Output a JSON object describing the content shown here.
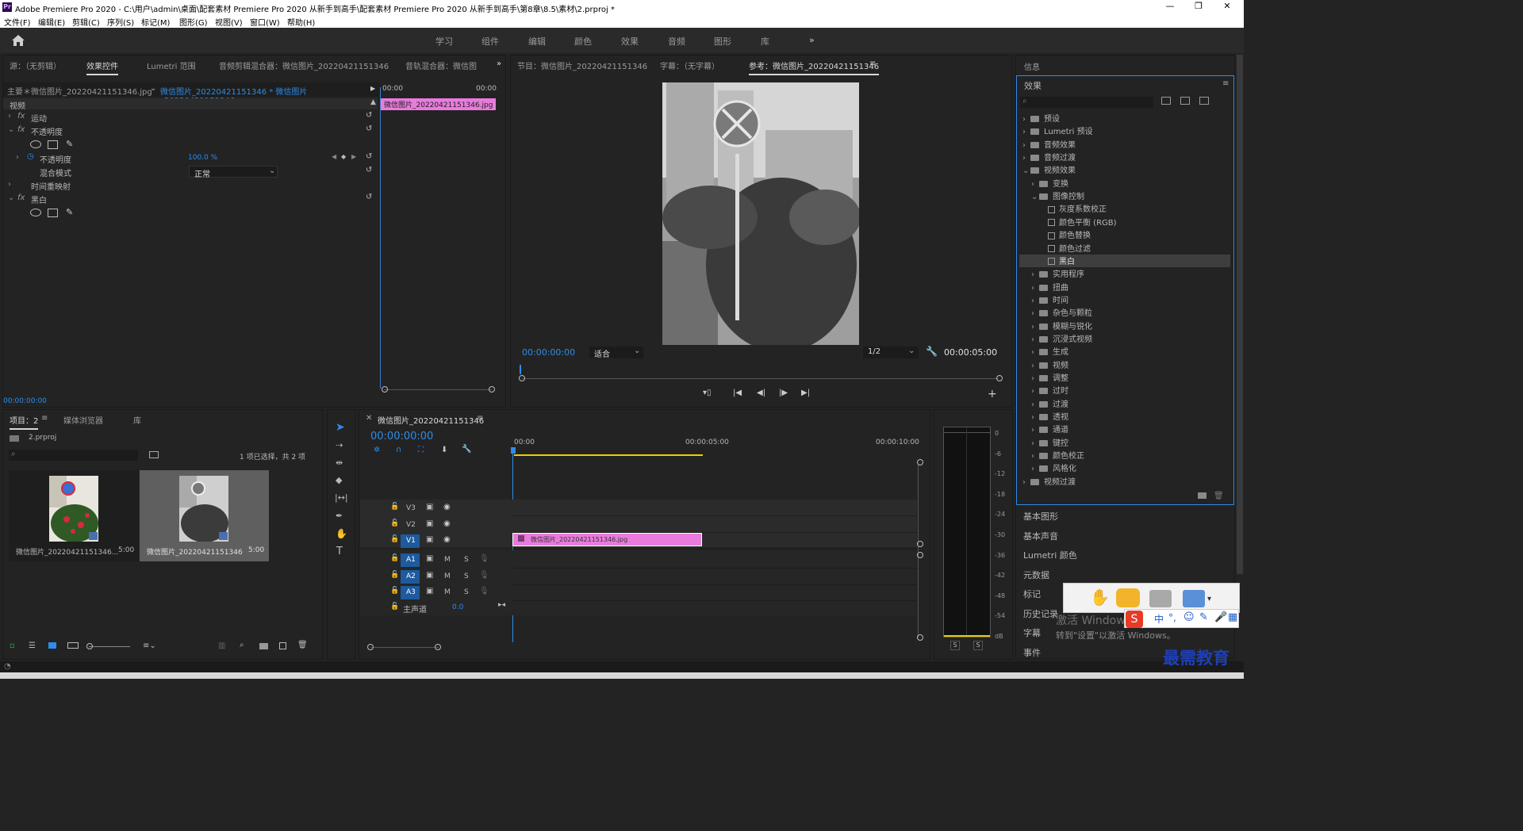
{
  "app": {
    "title": "Adobe Premiere Pro 2020 - C:\\用户\\admin\\桌面\\配套素材 Premiere Pro 2020 从新手到高手\\配套素材 Premiere Pro 2020 从新手到高手\\第8章\\8.5\\素材\\2.prproj *",
    "icon": "Pr",
    "min": "—",
    "max": "❐",
    "close": "✕"
  },
  "menu": [
    "文件(F)",
    "编辑(E)",
    "剪辑(C)",
    "序列(S)",
    "标记(M)",
    "图形(G)",
    "视图(V)",
    "窗口(W)",
    "帮助(H)"
  ],
  "workspaces": [
    "学习",
    "组件",
    "编辑",
    "颜色",
    "效果",
    "音频",
    "图形",
    "库"
  ],
  "workspace_more": "»",
  "source_panel": {
    "tabs": [
      "源：（无剪辑）",
      "效果控件",
      "Lumetri 范围",
      "音频剪辑混合器：微信图片_20220421151346",
      "音轨混合器：微信图"
    ],
    "more": "»",
    "master_label": "主要＊微信图片_20220421151346.jpg",
    "sequence_label": "微信图片_20220421151346 * 微信图片_20220421151346...",
    "time_left": "00:00",
    "time_right": "00:00",
    "clip_label": "微信图片_20220421151346.jpg",
    "video_header": "视频",
    "rows": {
      "motion": "运动",
      "opacity": "不透明度",
      "opacity_param": "不透明度",
      "opacity_value": "100.0 %",
      "blend_mode": "混合模式",
      "blend_value": "正常",
      "time_remap": "时间重映射",
      "bw": "黑白"
    },
    "fx": "fx",
    "timecode": "00:00:00:00"
  },
  "program_panel": {
    "tabs": [
      "节目：微信图片_20220421151346",
      "字幕：（无字幕）",
      "参考：微信图片_20220421151346"
    ],
    "timecode": "00:00:00:00",
    "fit": "适合",
    "resolution": "1/2",
    "duration": "00:00:05:00",
    "add": "+"
  },
  "project_panel": {
    "tabs": [
      "项目：2",
      "媒体浏览器",
      "库"
    ],
    "file": "2.prproj",
    "selection": "1 项已选择，共 2 项",
    "items": [
      {
        "name": "微信图片_20220421151346...",
        "duration": "5:00",
        "color": true
      },
      {
        "name": "微信图片_20220421151346",
        "duration": "5:00",
        "color": false
      }
    ]
  },
  "timeline": {
    "tab": "微信图片_20220421151346",
    "timecode": "00:00:00:00",
    "ruler": [
      "00:00",
      "00:00:05:00",
      "00:00:10:00"
    ],
    "video_tracks": [
      "V3",
      "V2",
      "V1"
    ],
    "audio_tracks": [
      "A1",
      "A2",
      "A3"
    ],
    "master": "主声道",
    "master_value": "0.0",
    "clip": "微信图片_20220421151346.jpg",
    "m": "M",
    "s": "S"
  },
  "meter": {
    "scale": [
      "0",
      "-6",
      "-12",
      "-18",
      "-24",
      "-30",
      "-36",
      "-42",
      "-48",
      "-54",
      "dB"
    ],
    "solo": [
      "S",
      "S"
    ]
  },
  "right_panel": {
    "info": "信息",
    "effects_title": "效果",
    "tree": [
      {
        "label": "预设",
        "level": 0,
        "type": "folder",
        "open": false
      },
      {
        "label": "Lumetri 预设",
        "level": 0,
        "type": "folder",
        "open": false
      },
      {
        "label": "音频效果",
        "level": 0,
        "type": "folder",
        "open": false
      },
      {
        "label": "音频过渡",
        "level": 0,
        "type": "folder",
        "open": false
      },
      {
        "label": "视频效果",
        "level": 0,
        "type": "folder",
        "open": true
      },
      {
        "label": "变换",
        "level": 1,
        "type": "folder",
        "open": false
      },
      {
        "label": "图像控制",
        "level": 1,
        "type": "folder",
        "open": true
      },
      {
        "label": "灰度系数校正",
        "level": 2,
        "type": "fx"
      },
      {
        "label": "颜色平衡 (RGB)",
        "level": 2,
        "type": "fx"
      },
      {
        "label": "颜色替换",
        "level": 2,
        "type": "fx"
      },
      {
        "label": "颜色过滤",
        "level": 2,
        "type": "fx"
      },
      {
        "label": "黑白",
        "level": 2,
        "type": "fx",
        "selected": true
      },
      {
        "label": "实用程序",
        "level": 1,
        "type": "folder",
        "open": false
      },
      {
        "label": "扭曲",
        "level": 1,
        "type": "folder",
        "open": false
      },
      {
        "label": "时间",
        "level": 1,
        "type": "folder",
        "open": false
      },
      {
        "label": "杂色与颗粒",
        "level": 1,
        "type": "folder",
        "open": false
      },
      {
        "label": "模糊与锐化",
        "level": 1,
        "type": "folder",
        "open": false
      },
      {
        "label": "沉浸式视频",
        "level": 1,
        "type": "folder",
        "open": false
      },
      {
        "label": "生成",
        "level": 1,
        "type": "folder",
        "open": false
      },
      {
        "label": "视频",
        "level": 1,
        "type": "folder",
        "open": false
      },
      {
        "label": "调整",
        "level": 1,
        "type": "folder",
        "open": false
      },
      {
        "label": "过时",
        "level": 1,
        "type": "folder",
        "open": false
      },
      {
        "label": "过渡",
        "level": 1,
        "type": "folder",
        "open": false
      },
      {
        "label": "透视",
        "level": 1,
        "type": "folder",
        "open": false
      },
      {
        "label": "通道",
        "level": 1,
        "type": "folder",
        "open": false
      },
      {
        "label": "键控",
        "level": 1,
        "type": "folder",
        "open": false
      },
      {
        "label": "颜色校正",
        "level": 1,
        "type": "folder",
        "open": false
      },
      {
        "label": "风格化",
        "level": 1,
        "type": "folder",
        "open": false
      },
      {
        "label": "视频过渡",
        "level": 0,
        "type": "folder",
        "open": false
      }
    ],
    "sections": [
      "基本图形",
      "基本声音",
      "Lumetri 颜色",
      "元数据",
      "标记",
      "历史记录",
      "字幕",
      "事件"
    ]
  },
  "overlay": {
    "activate": "激活 Windows",
    "activate_sub": "转到\"设置\"以激活 Windows。",
    "ime": "中",
    "watermark": "最需教育"
  }
}
